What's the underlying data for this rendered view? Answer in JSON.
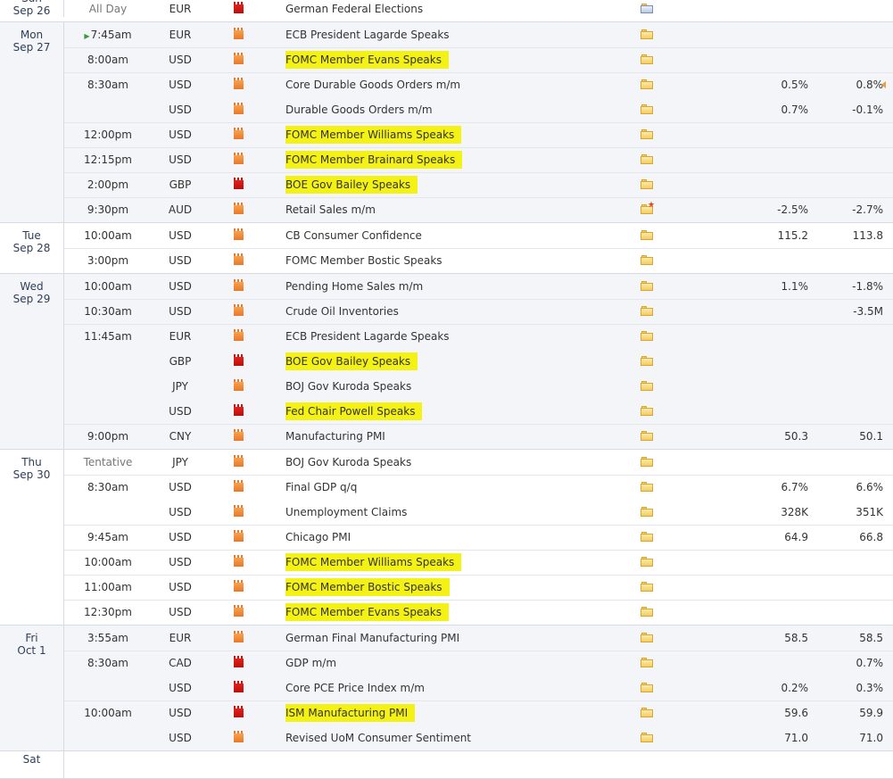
{
  "days": [
    {
      "name": "Sun",
      "date": "Sep 26",
      "rows": [
        {
          "time": "All Day",
          "currency": "EUR",
          "impact": "high",
          "event": "German Federal Elections",
          "highlight": false,
          "note": "doc",
          "actual": "",
          "forecast": ""
        }
      ]
    },
    {
      "name": "Mon",
      "date": "Sep 27",
      "rows": [
        {
          "time": "7:45am",
          "current": true,
          "currency": "EUR",
          "impact": "medium",
          "event": "ECB President Lagarde Speaks",
          "highlight": false,
          "note": "folder",
          "actual": "",
          "forecast": ""
        },
        {
          "time": "8:00am",
          "currency": "USD",
          "impact": "medium",
          "event": "FOMC Member Evans Speaks",
          "highlight": true,
          "note": "folder",
          "actual": "",
          "forecast": ""
        },
        {
          "time": "8:30am",
          "currency": "USD",
          "impact": "medium",
          "event": "Core Durable Goods Orders m/m",
          "highlight": false,
          "note": "folder",
          "actual": "0.5%",
          "forecast": "0.8%",
          "arrow": true
        },
        {
          "time": "",
          "currency": "USD",
          "impact": "medium",
          "event": "Durable Goods Orders m/m",
          "highlight": false,
          "note": "folder",
          "actual": "0.7%",
          "forecast": "-0.1%"
        },
        {
          "time": "12:00pm",
          "currency": "USD",
          "impact": "medium",
          "event": "FOMC Member Williams Speaks",
          "highlight": true,
          "note": "folder",
          "actual": "",
          "forecast": ""
        },
        {
          "time": "12:15pm",
          "currency": "USD",
          "impact": "medium",
          "event": "FOMC Member Brainard Speaks",
          "highlight": true,
          "note": "folder",
          "actual": "",
          "forecast": ""
        },
        {
          "time": "2:00pm",
          "currency": "GBP",
          "impact": "high",
          "event": "BOE Gov Bailey Speaks",
          "highlight": true,
          "note": "folder",
          "actual": "",
          "forecast": ""
        },
        {
          "time": "9:30pm",
          "currency": "AUD",
          "impact": "medium",
          "event": "Retail Sales m/m",
          "highlight": false,
          "note": "folder-new",
          "actual": "-2.5%",
          "forecast": "-2.7%"
        }
      ]
    },
    {
      "name": "Tue",
      "date": "Sep 28",
      "rows": [
        {
          "time": "10:00am",
          "currency": "USD",
          "impact": "medium",
          "event": "CB Consumer Confidence",
          "highlight": false,
          "note": "folder",
          "actual": "115.2",
          "forecast": "113.8"
        },
        {
          "time": "3:00pm",
          "currency": "USD",
          "impact": "medium",
          "event": "FOMC Member Bostic Speaks",
          "highlight": false,
          "note": "folder",
          "actual": "",
          "forecast": ""
        }
      ]
    },
    {
      "name": "Wed",
      "date": "Sep 29",
      "rows": [
        {
          "time": "10:00am",
          "currency": "USD",
          "impact": "medium",
          "event": "Pending Home Sales m/m",
          "highlight": false,
          "note": "folder",
          "actual": "1.1%",
          "forecast": "-1.8%"
        },
        {
          "time": "10:30am",
          "currency": "USD",
          "impact": "medium",
          "event": "Crude Oil Inventories",
          "highlight": false,
          "note": "folder",
          "actual": "",
          "forecast": "-3.5M"
        },
        {
          "time": "11:45am",
          "currency": "EUR",
          "impact": "medium",
          "event": "ECB President Lagarde Speaks",
          "highlight": false,
          "note": "folder",
          "actual": "",
          "forecast": ""
        },
        {
          "time": "",
          "currency": "GBP",
          "impact": "high",
          "event": "BOE Gov Bailey Speaks",
          "highlight": true,
          "note": "folder",
          "actual": "",
          "forecast": ""
        },
        {
          "time": "",
          "currency": "JPY",
          "impact": "medium",
          "event": "BOJ Gov Kuroda Speaks",
          "highlight": false,
          "note": "folder",
          "actual": "",
          "forecast": ""
        },
        {
          "time": "",
          "currency": "USD",
          "impact": "high",
          "event": "Fed Chair Powell Speaks",
          "highlight": true,
          "note": "folder",
          "actual": "",
          "forecast": ""
        },
        {
          "time": "9:00pm",
          "currency": "CNY",
          "impact": "medium",
          "event": "Manufacturing PMI",
          "highlight": false,
          "note": "folder",
          "actual": "50.3",
          "forecast": "50.1"
        }
      ]
    },
    {
      "name": "Thu",
      "date": "Sep 30",
      "rows": [
        {
          "time": "Tentative",
          "currency": "JPY",
          "impact": "medium",
          "event": "BOJ Gov Kuroda Speaks",
          "highlight": false,
          "note": "folder",
          "actual": "",
          "forecast": ""
        },
        {
          "time": "8:30am",
          "currency": "USD",
          "impact": "medium",
          "event": "Final GDP q/q",
          "highlight": false,
          "note": "folder",
          "actual": "6.7%",
          "forecast": "6.6%"
        },
        {
          "time": "",
          "currency": "USD",
          "impact": "medium",
          "event": "Unemployment Claims",
          "highlight": false,
          "note": "folder",
          "actual": "328K",
          "forecast": "351K"
        },
        {
          "time": "9:45am",
          "currency": "USD",
          "impact": "medium",
          "event": "Chicago PMI",
          "highlight": false,
          "note": "folder",
          "actual": "64.9",
          "forecast": "66.8"
        },
        {
          "time": "10:00am",
          "currency": "USD",
          "impact": "medium",
          "event": "FOMC Member Williams Speaks",
          "highlight": true,
          "note": "folder",
          "actual": "",
          "forecast": ""
        },
        {
          "time": "11:00am",
          "currency": "USD",
          "impact": "medium",
          "event": "FOMC Member Bostic Speaks",
          "highlight": true,
          "note": "folder",
          "actual": "",
          "forecast": ""
        },
        {
          "time": "12:30pm",
          "currency": "USD",
          "impact": "medium",
          "event": "FOMC Member Evans Speaks",
          "highlight": true,
          "note": "folder",
          "actual": "",
          "forecast": ""
        }
      ]
    },
    {
      "name": "Fri",
      "date": "Oct 1",
      "rows": [
        {
          "time": "3:55am",
          "currency": "EUR",
          "impact": "medium",
          "event": "German Final Manufacturing PMI",
          "highlight": false,
          "note": "folder",
          "actual": "58.5",
          "forecast": "58.5"
        },
        {
          "time": "8:30am",
          "currency": "CAD",
          "impact": "high",
          "event": "GDP m/m",
          "highlight": false,
          "note": "folder",
          "actual": "",
          "forecast": "0.7%"
        },
        {
          "time": "",
          "currency": "USD",
          "impact": "high",
          "event": "Core PCE Price Index m/m",
          "highlight": false,
          "note": "folder",
          "actual": "0.2%",
          "forecast": "0.3%"
        },
        {
          "time": "10:00am",
          "currency": "USD",
          "impact": "high",
          "event": "ISM Manufacturing PMI",
          "highlight": true,
          "note": "folder",
          "actual": "59.6",
          "forecast": "59.9"
        },
        {
          "time": "",
          "currency": "USD",
          "impact": "medium",
          "event": "Revised UoM Consumer Sentiment",
          "highlight": false,
          "note": "folder",
          "actual": "71.0",
          "forecast": "71.0"
        }
      ]
    },
    {
      "name": "Sat",
      "date": "",
      "rows": []
    }
  ],
  "colors": {
    "highlight": "#f4f114",
    "high_impact": "#d0160f",
    "medium_impact": "#ef8a36",
    "day_band_alt": "#f4f5f8"
  },
  "icons": {
    "current_time": "play-triangle-icon",
    "note": "folder-icon",
    "doc": "document-icon",
    "new": "star-icon",
    "revision": "left-arrow-icon"
  }
}
